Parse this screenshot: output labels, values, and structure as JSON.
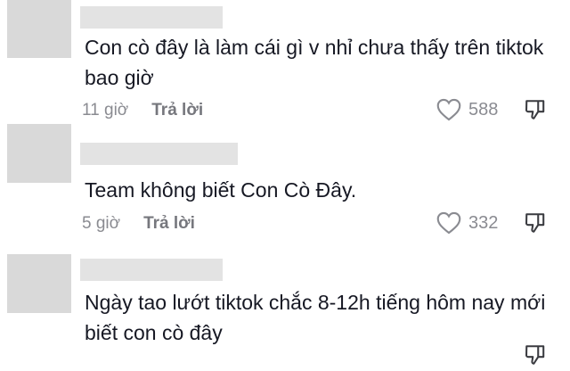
{
  "comments": [
    {
      "text": "Con cò đây là làm cái gì v nhỉ chưa thấy trên tiktok bao giờ",
      "time": "11 giờ",
      "reply_label": "Trả lời",
      "likes": "588",
      "icons": {
        "like": "heart-icon",
        "dislike": "thumbs-down-icon"
      }
    },
    {
      "text": "Team không biết Con Cò Đây.",
      "time": "5 giờ",
      "reply_label": "Trả lời",
      "likes": "332",
      "icons": {
        "like": "heart-icon",
        "dislike": "thumbs-down-icon"
      }
    },
    {
      "text": "Ngày tao lướt tiktok chắc 8-12h tiếng hôm nay mới biết con cò đây"
    }
  ],
  "colors": {
    "avatar_placeholder": "#d9d9d9",
    "name_placeholder": "#e3e3e3",
    "meta_text": "#8a8b91"
  }
}
